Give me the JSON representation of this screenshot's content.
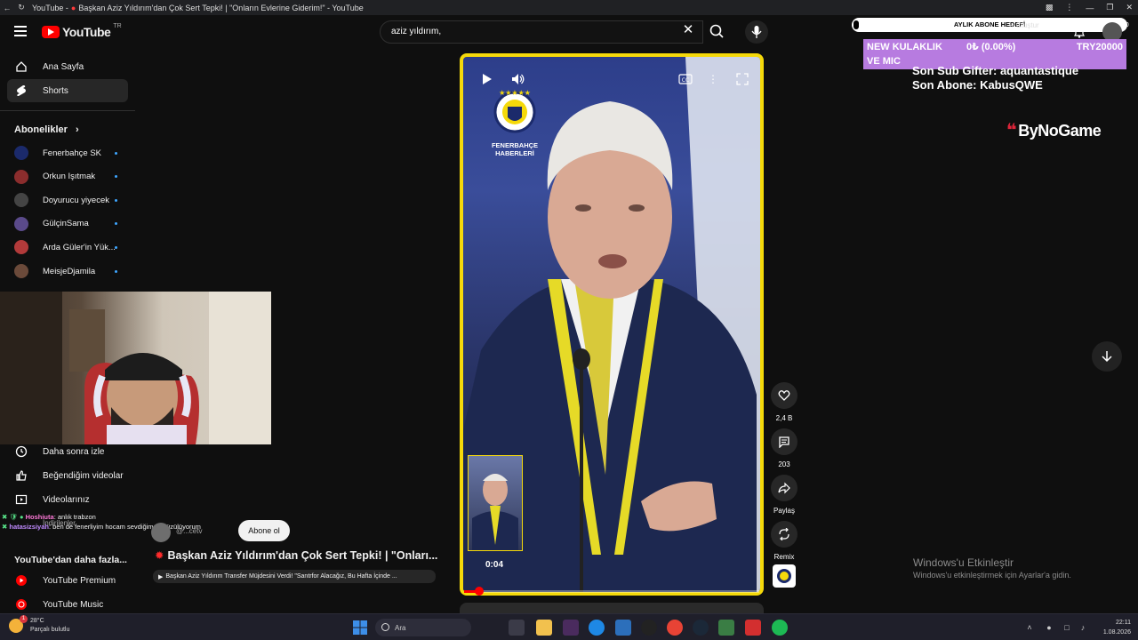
{
  "browser": {
    "tab_title_prefix": "YouTube -",
    "tab_title": "Başkan Aziz Yıldırım'dan Çok Sert Tepki! | \"Onların Evlerine Giderim!\" - YouTube"
  },
  "header": {
    "logo_text": "YouTube",
    "country_code": "TR",
    "search_value": "aziz yıldırım,",
    "create_label": "Oluştur",
    "user_count": "40"
  },
  "sidebar": {
    "home_label": "Ana Sayfa",
    "shorts_label": "Shorts",
    "subs_heading": "Abonelikler",
    "subscriptions": [
      {
        "name": "Fenerbahçe SK",
        "color": "#1b2a6b"
      },
      {
        "name": "Orkun Işıtmak",
        "color": "#8b2d2d"
      },
      {
        "name": "Doyurucu yiyecek",
        "color": "#444444"
      },
      {
        "name": "GülçinSama",
        "color": "#5a4a8a"
      },
      {
        "name": "Arda Güler'in Yük...",
        "color": "#b23a3a"
      },
      {
        "name": "MeisjeDjamila",
        "color": "#6b4a3a"
      }
    ],
    "later_label": "Daha sonra izle",
    "liked_label": "Beğendiğim videolar",
    "your_videos_label": "Videolarınız",
    "downloads_label": "İndirilenler",
    "more_heading": "YouTube'dan daha fazla...",
    "premium_label": "YouTube Premium",
    "music_label": "YouTube Music"
  },
  "chat": [
    {
      "user": "Hoshiuta",
      "message": ": anlık trabzon"
    },
    {
      "user": "hatasizsiyah",
      "message": ": ben de fenerliyim hocam sevdiğimden üzülüyorum"
    }
  ],
  "video": {
    "channel_logo_line1": "FENERBAHÇE",
    "channel_logo_line2": "HABERLERİ",
    "time": "0:04",
    "progress": 0.05,
    "likes": "2,4 B",
    "comments": "203",
    "share_label": "Paylaş",
    "remix_label": "Remix",
    "subscribe_label": "Abone ol",
    "channel_handle": "@...cetv",
    "title": "Başkan Aziz Yıldırım'dan Çok Sert Tepki! | \"Onları...",
    "related_title": "Başkan Aziz Yıldırım Transfer Müjdesini Verdi! \"Santrfor Alacağız, Bu Hafta İçinde ..."
  },
  "stream_overlay": {
    "bar_label": "AYLIK ABONE HEDEFİ",
    "goal_col1": "NEW KULAKLIK",
    "goal_col2": "0₺ (0.00%)",
    "goal_col3": "TRY20000",
    "goal_col4": "VE MIC",
    "last_gifter": "Son Sub Gifter: aquantastique",
    "last_sub": "Son Abone: KabusQWE",
    "sponsor": "ByNoGame"
  },
  "windows": {
    "activate_title": "Windows'u Etkinleştir",
    "activate_sub": "Windows'u etkinleştirmek için Ayarlar'a gidin.",
    "weather_temp": "28°C",
    "weather_desc": "Parçalı bulutlu",
    "weather_badge": "1",
    "search_label": "Ara",
    "time": "22:11",
    "date": "1.08.2026"
  },
  "colors": {
    "accent": "#ff0000",
    "frame": "#f5d90a",
    "goal_bg": "#b77be0"
  }
}
